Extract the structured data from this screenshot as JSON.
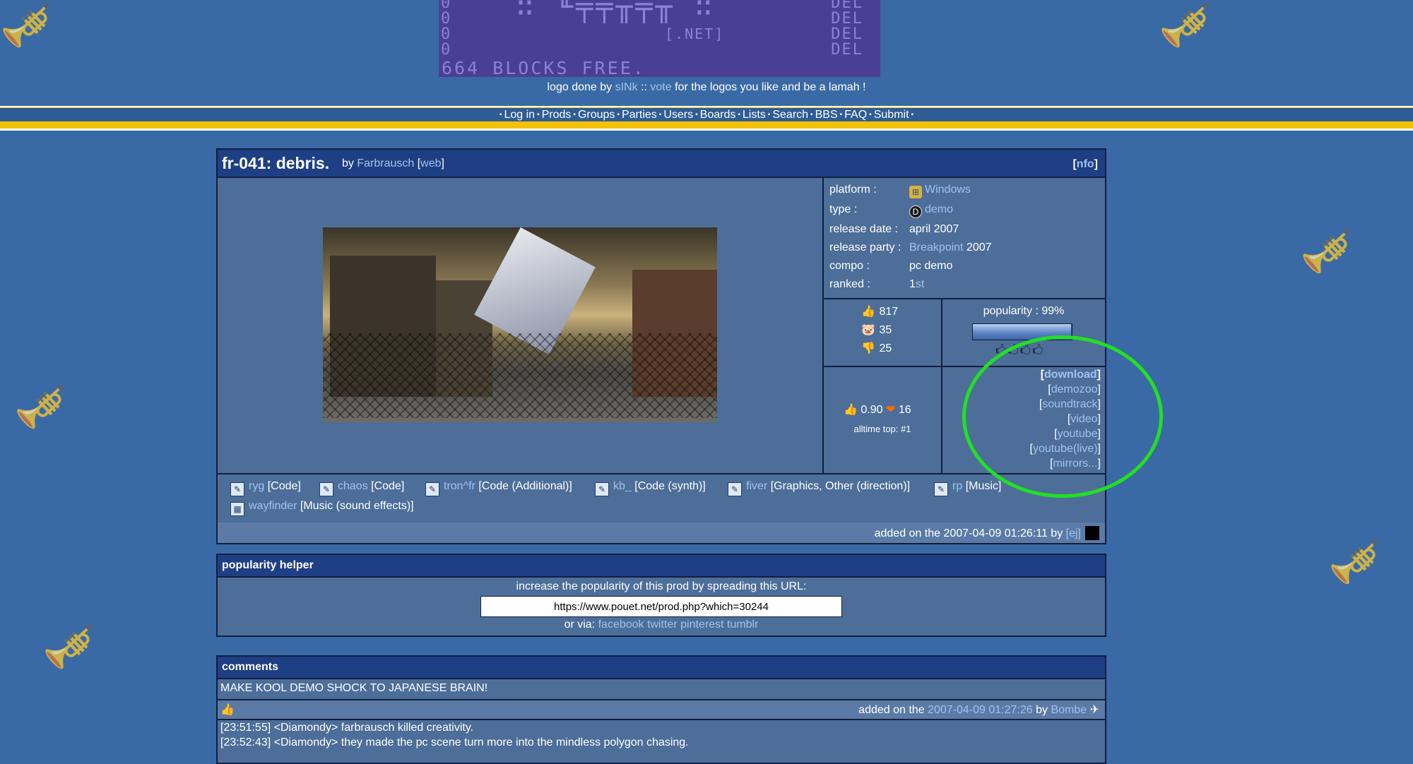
{
  "logo": {
    "zeros": [
      "0",
      "0",
      "0",
      "0"
    ],
    "dels": [
      "DEL",
      "DEL",
      "DEL",
      "DEL"
    ],
    "art": "∷ ╙╤╤╥╤╥ ∷",
    "net": "[.NET]",
    "blocks": "664 BLOCKS FREE.",
    "credit_prefix": "logo done by",
    "credit_author": "sINk",
    "credit_sep": "::",
    "credit_vote": "vote",
    "credit_suffix": "for the logos you like and be a lamah !"
  },
  "nav": {
    "items": [
      "Log in",
      "Prods",
      "Groups",
      "Parties",
      "Users",
      "Boards",
      "Lists",
      "Search",
      "BBS",
      "FAQ",
      "Submit"
    ],
    "sep": "▪"
  },
  "prod": {
    "title": "fr-041: debris.",
    "by_label": "by",
    "group": "Farbrausch",
    "web_label": "web",
    "nfo_label": "nfo",
    "info": {
      "platform_label": "platform :",
      "platform": "Windows",
      "type_label": "type :",
      "type": "demo",
      "release_date_label": "release date :",
      "release_date": "april 2007",
      "release_party_label": "release party :",
      "release_party": "Breakpoint",
      "release_party_year": "2007",
      "compo_label": "compo :",
      "compo": "pc demo",
      "ranked_label": "ranked :",
      "ranked_num": "1",
      "ranked_suffix": "st"
    },
    "votes": {
      "rulez": "817",
      "piggie": "35",
      "sucks": "25"
    },
    "popularity_label": "popularity : 99%",
    "popularity_value": 0.99,
    "cdc": {
      "average": "0.90",
      "count": "16",
      "alltime": "alltime top: #1"
    },
    "links": [
      "download",
      "demozoo",
      "soundtrack",
      "video",
      "youtube",
      "youtube(live)",
      "mirrors..."
    ],
    "credits": [
      {
        "name": "ryg",
        "role": "[Code]"
      },
      {
        "name": "chaos",
        "role": "[Code]"
      },
      {
        "name": "tron^fr",
        "role": "[Code (Additional)]"
      },
      {
        "name": "kb_",
        "role": "[Code (synth)]"
      },
      {
        "name": "fiver",
        "role": "[Graphics, Other (direction)]"
      },
      {
        "name": "rp",
        "role": "[Music]"
      },
      {
        "name": "wayfinder",
        "role": "[Music (sound effects)]"
      }
    ],
    "added_text": "added on the 2007-04-09 01:26:11 by",
    "added_user": "[ej]"
  },
  "helper": {
    "title": "popularity helper",
    "text": "increase the popularity of this prod by spreading this URL:",
    "url": "https://www.pouet.net/prod.php?which=30244",
    "via_label": "or via:",
    "via_links": [
      "facebook",
      "twitter",
      "pinterest",
      "tumblr"
    ]
  },
  "comments": {
    "title": "comments",
    "c1_text": "MAKE KOOL DEMO SHOCK TO JAPANESE BRAIN!",
    "c1_added_prefix": "added on the",
    "c1_date": "2007-04-09 01:27:26",
    "c1_by": "by",
    "c1_user": "Bombe",
    "c2_line1": "[23:51:55] <Diamondy> farbrausch killed creativity.",
    "c2_line2": "[23:52:43] <Diamondy> they made the pc scene turn more into the mindless polygon chasing."
  },
  "icons": {
    "rulez": "thumbs-up-icon",
    "piggie": "pig-icon",
    "sucks": "thumbs-down-icon",
    "background": "trumpet-icon"
  },
  "colors": {
    "background": "#3a6aa5",
    "header": "#1f3f84",
    "nav_yellow": "#f2c200",
    "link": "#9fc3f0",
    "annotation_circle": "#22e022"
  }
}
